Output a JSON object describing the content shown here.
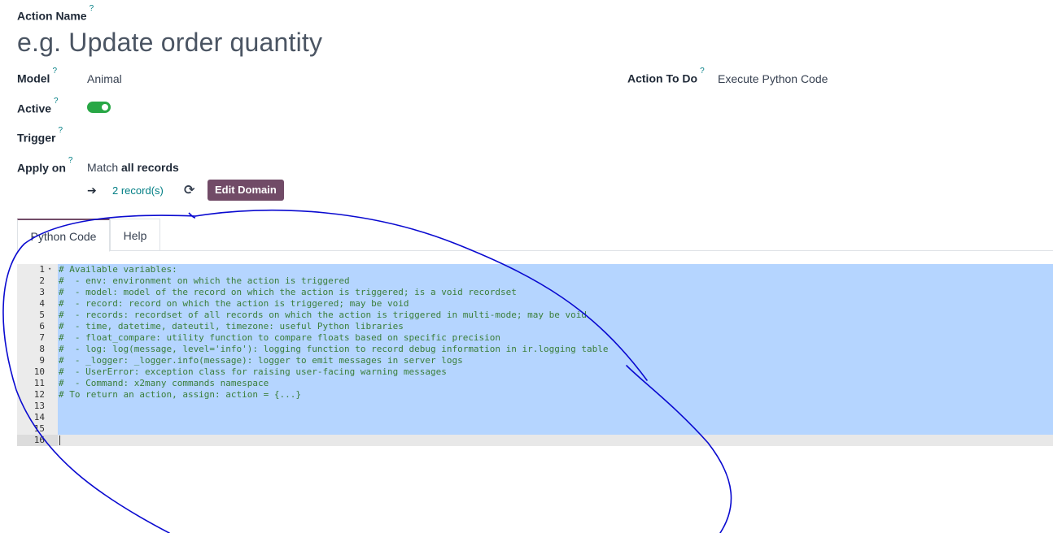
{
  "form": {
    "action_name_label": "Action Name",
    "action_name_placeholder": "e.g. Update order quantity",
    "model_label": "Model",
    "model_value": "Animal",
    "action_to_do_label": "Action To Do",
    "action_to_do_value": "Execute Python Code",
    "active_label": "Active",
    "active_value": true,
    "trigger_label": "Trigger",
    "apply_on_label": "Apply on",
    "apply_on_prefix": "Match",
    "apply_on_bold": "all records",
    "records_link": "2 record(s)",
    "edit_domain_button": "Edit Domain",
    "help_mark": "?",
    "arrow": "➔",
    "refresh_icon": "⟳"
  },
  "tabs": [
    {
      "label": "Python Code",
      "active": true
    },
    {
      "label": "Help",
      "active": false
    }
  ],
  "editor": {
    "line_numbers": [
      "1",
      "2",
      "3",
      "4",
      "5",
      "6",
      "7",
      "8",
      "9",
      "10",
      "11",
      "12",
      "13",
      "14",
      "15",
      "16"
    ],
    "lines": [
      "# Available variables:",
      "#  - env: environment on which the action is triggered",
      "#  - model: model of the record on which the action is triggered; is a void recordset",
      "#  - record: record on which the action is triggered; may be void",
      "#  - records: recordset of all records on which the action is triggered in multi-mode; may be void",
      "#  - time, datetime, dateutil, timezone: useful Python libraries",
      "#  - float_compare: utility function to compare floats based on specific precision",
      "#  - log: log(message, level='info'): logging function to record debug information in ir.logging table",
      "#  - _logger: _logger.info(message): logger to emit messages in server logs",
      "#  - UserError: exception class for raising user-facing warning messages",
      "#  - Command: x2many commands namespace",
      "# To return an action, assign: action = {...}",
      "",
      "",
      "",
      ""
    ],
    "comment_color": "#3a7e3a",
    "selection_color": "#b5d5ff"
  },
  "colors": {
    "brand": "#714b67",
    "link": "#017e84",
    "toggle_on": "#28a745",
    "annotation_ink": "#0a0ad0"
  }
}
